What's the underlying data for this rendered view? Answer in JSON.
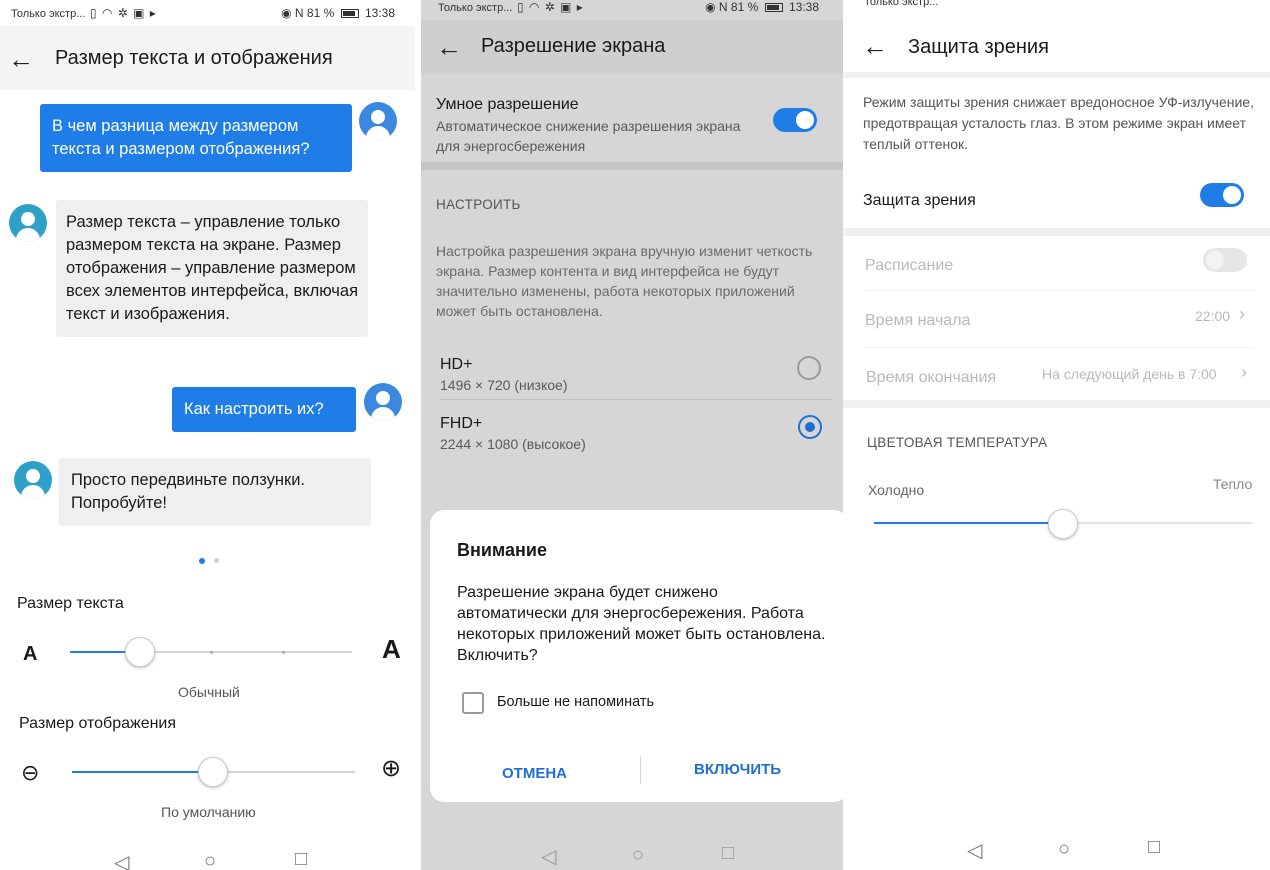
{
  "screen1": {
    "status": {
      "carrier": "Только экстр...",
      "battery": "81 %",
      "time": "13:38"
    },
    "title": "Размер текста и отображения",
    "chat": [
      {
        "from": "user",
        "text": "В чем разница между размером текста и размером отображения?"
      },
      {
        "from": "bot",
        "text": "Размер текста – управление только размером текста на экране. Размер отображения – управление размером всех элементов интерфейса, включая текст и изображения."
      },
      {
        "from": "user",
        "text": "Как настроить их?"
      },
      {
        "from": "bot",
        "text": "Просто передвиньте ползунки. Попробуйте!"
      }
    ],
    "page_dots": {
      "count": 2,
      "active": 1
    },
    "text_size": {
      "label": "Размер текста",
      "small_glyph": "A",
      "large_glyph": "A",
      "value_label": "Обычный",
      "steps": 4,
      "position": 1
    },
    "display_size": {
      "label": "Размер отображения",
      "value_label": "По умолчанию",
      "position_fraction": 0.5
    }
  },
  "screen2": {
    "status": {
      "carrier": "Только экстр...",
      "battery": "81 %",
      "time": "13:38"
    },
    "title": "Разрешение экрана",
    "smart": {
      "title": "Умное разрешение",
      "subtitle": "Автоматическое снижение разрешения экрана для энергосбережения",
      "enabled": true
    },
    "section_header": "НАСТРОИТЬ",
    "section_desc": "Настройка разрешения экрана вручную изменит четкость экрана. Размер контента и вид интерфейса не будут значительно изменены, работа некоторых приложений может быть остановлена.",
    "options": [
      {
        "title": "HD+",
        "subtitle": "1496 × 720 (низкое)",
        "selected": false
      },
      {
        "title": "FHD+",
        "subtitle": "2244 × 1080 (высокое)",
        "selected": true
      }
    ],
    "dialog": {
      "title": "Внимание",
      "message": "Разрешение экрана будет снижено автоматически для энергосбережения. Работа некоторых приложений может быть остановлена. Включить?",
      "checkbox_label": "Больше не напоминать",
      "cancel": "ОТМЕНА",
      "confirm": "ВКЛЮЧИТЬ"
    }
  },
  "screen3": {
    "status": {
      "carrier": "Только экстр..."
    },
    "title": "Защита зрения",
    "description": "Режим защиты зрения снижает вредоносное УФ-излучение, предотвращая усталость глаз. В этом режиме экран имеет теплый оттенок.",
    "eye_protection": {
      "label": "Защита зрения",
      "enabled": true
    },
    "schedule": {
      "label": "Расписание",
      "enabled": false
    },
    "start_time": {
      "label": "Время начала",
      "value": "22:00"
    },
    "end_time": {
      "label": "Время окончания",
      "value": "На следующий день в 7:00"
    },
    "color_temp": {
      "header": "ЦВЕТОВАЯ ТЕМПЕРАТУРА",
      "cold": "Холодно",
      "warm": "Тепло",
      "position_fraction": 0.5
    }
  },
  "colors": {
    "accent": "#1f7de8",
    "dialog_accent": "#1f6fd2",
    "scrim": "#d6d6d6"
  }
}
